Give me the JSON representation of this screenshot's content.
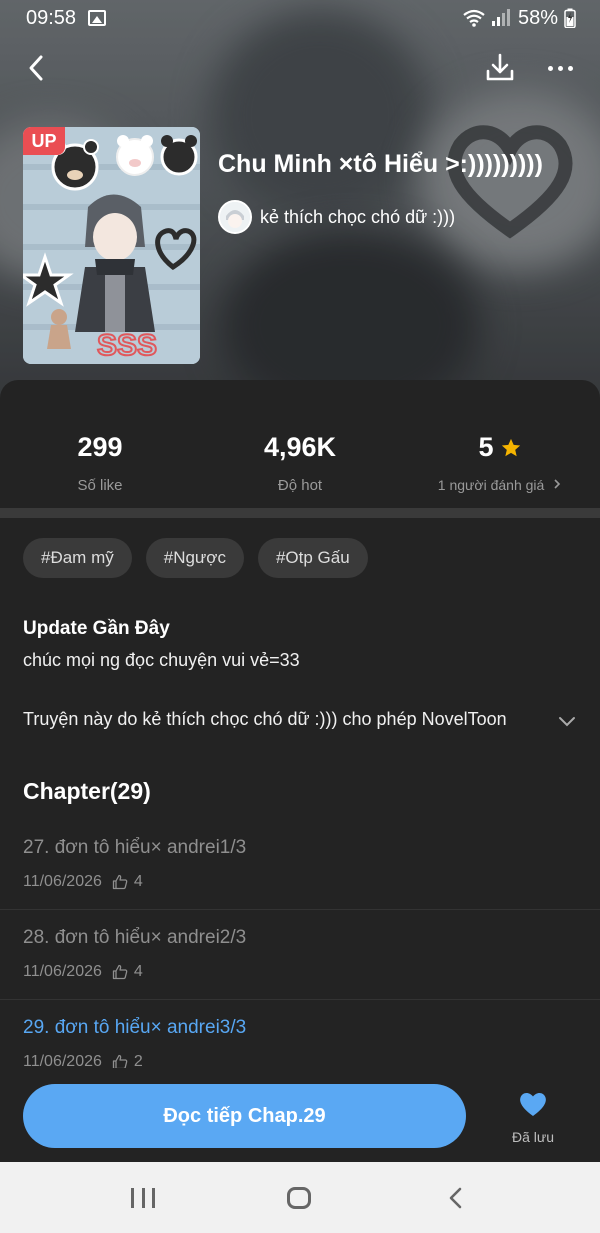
{
  "status_bar": {
    "time": "09:58",
    "battery": "58%",
    "icons": [
      "gallery-icon",
      "wifi-icon",
      "signal-icon",
      "battery-charging-icon"
    ]
  },
  "nav": {
    "back_icon": "chevron-left-icon",
    "download_icon": "download-icon",
    "more_icon": "more-horizontal-icon"
  },
  "story": {
    "badge": "UP",
    "title": "Chu Minh ×tô Hiểu >:)))))))))",
    "author": "kẻ thích chọc chó dữ :)))"
  },
  "stats": [
    {
      "value": "299",
      "label": "Số like"
    },
    {
      "value": "4,96K",
      "label": "Độ hot"
    },
    {
      "value": "5",
      "label": "1 người đánh giá",
      "icon": "star-icon"
    }
  ],
  "tags": [
    "#Đam mỹ",
    "#Ngược",
    "#Otp Gấu"
  ],
  "update": {
    "heading": "Update Gần Đây",
    "text": "chúc mọi ng đọc chuyện vui vẻ=33"
  },
  "description": "Truyện này do kẻ thích chọc chó dữ :))) cho phép NovelToon",
  "chapters_heading": "Chapter(29)",
  "chapters": [
    {
      "title": "27. đơn tô hiểu× andrei1/3",
      "date": "11/06/2026",
      "likes": "4"
    },
    {
      "title": "28. đơn tô hiểu× andrei2/3",
      "date": "11/06/2026",
      "likes": "4"
    },
    {
      "title": "29. đơn tô hiểu× andrei3/3",
      "date": "11/06/2026",
      "likes": "2"
    }
  ],
  "action": {
    "read_label": "Đọc tiếp Chap.29",
    "saved_label": "Đã lưu"
  },
  "colors": {
    "accent": "#5aa8f3",
    "badge": "#ea4e53",
    "star": "#f5b400",
    "background": "#232323"
  }
}
